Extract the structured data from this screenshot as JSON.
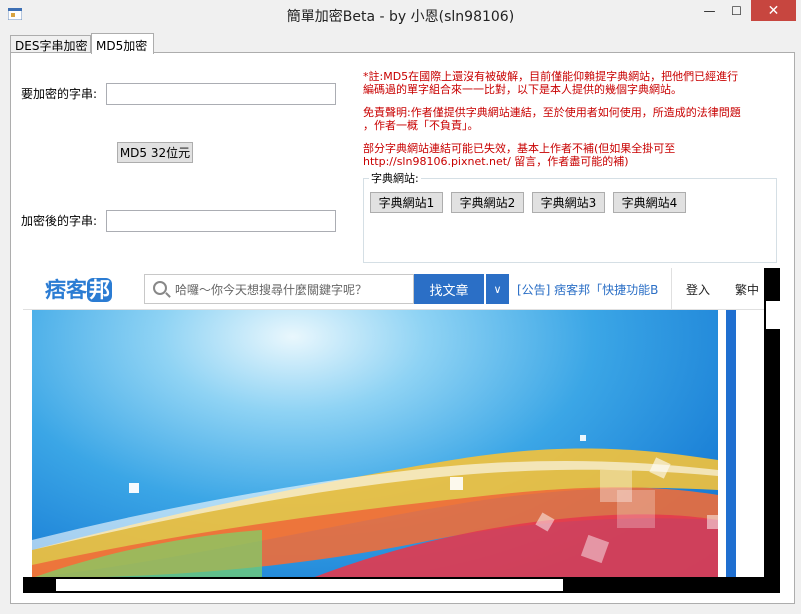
{
  "window": {
    "title": "簡單加密Beta - by 小恩(sln98106)",
    "min_glyph": "—",
    "max_glyph": "☐",
    "close_glyph": "✕"
  },
  "tabs": [
    {
      "label": "DES字串加密"
    },
    {
      "label": "MD5加密"
    }
  ],
  "form": {
    "input_label": "要加密的字串:",
    "input_value": "",
    "md5_button": "MD5 32位元",
    "output_label": "加密後的字串:",
    "output_value": ""
  },
  "notes": {
    "note1_line1": "*註:MD5在國際上還沒有被破解，目前僅能仰賴提字典網站，把他們已經進行",
    "note1_line2": "編碼過的單字組合來一一比對，以下是本人提供的幾個字典網站。",
    "note2_line1": "免責聲明:作者僅提供字典網站連結，至於使用者如何使用，所造成的法律問題",
    "note2_line2": "，作者一概「不負責」。",
    "note3_line1": "部分字典網站連結可能已失效，基本上作者不補(但如果全掛可至",
    "note3_line2": "http://sln98106.pixnet.net/ 留言，作者盡可能的補)"
  },
  "dictionary": {
    "group_label": "字典網站:",
    "buttons": [
      "字典網站1",
      "字典網站2",
      "字典網站3",
      "字典網站4"
    ]
  },
  "browser": {
    "logo_text": "痞客",
    "logo_badge": "邦",
    "search_placeholder": "哈囉～你今天想搜尋什麼關鍵字呢？",
    "search_button": "找文章",
    "dropdown_glyph": "∨",
    "announcement": "[公告] 痞客邦「快捷功能B",
    "login": "登入",
    "language": "繁中"
  },
  "colors": {
    "note_red": "#c80000",
    "pixnet_blue": "#2b6fc6",
    "close_red": "#c7463f"
  }
}
